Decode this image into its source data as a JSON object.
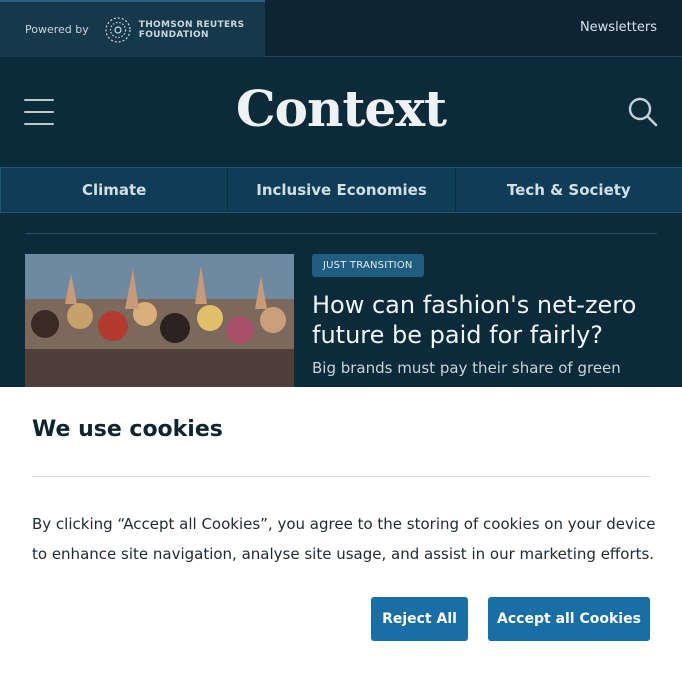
{
  "topbar": {
    "powered_by": "Powered by",
    "foundation_line1": "THOMSON REUTERS",
    "foundation_line2": "FOUNDATION",
    "newsletters": "Newsletters"
  },
  "header": {
    "logo": "Context",
    "menu_icon": "hamburger-menu-icon",
    "search_icon": "search-icon"
  },
  "nav": {
    "tabs": [
      {
        "label": "Climate"
      },
      {
        "label": "Inclusive Economies"
      },
      {
        "label": "Tech & Society"
      }
    ]
  },
  "article": {
    "tag": "JUST TRANSITION",
    "headline": "How can fashion's net-zero future be paid for fairly?",
    "standfirst": "Big brands must pay their share of green"
  },
  "cookie_banner": {
    "title": "We use cookies",
    "body": "By clicking “Accept all Cookies”, you agree to the storing of cookies on your device to enhance site navigation, analyse site usage, and assist in our marketing efforts.",
    "reject_label": "Reject All",
    "accept_label": "Accept all Cookies"
  },
  "colors": {
    "page_background": "#0b2a3a",
    "nav_background": "#0f3d57",
    "button": "#1a6ea6",
    "tag": "#1f5e80"
  }
}
